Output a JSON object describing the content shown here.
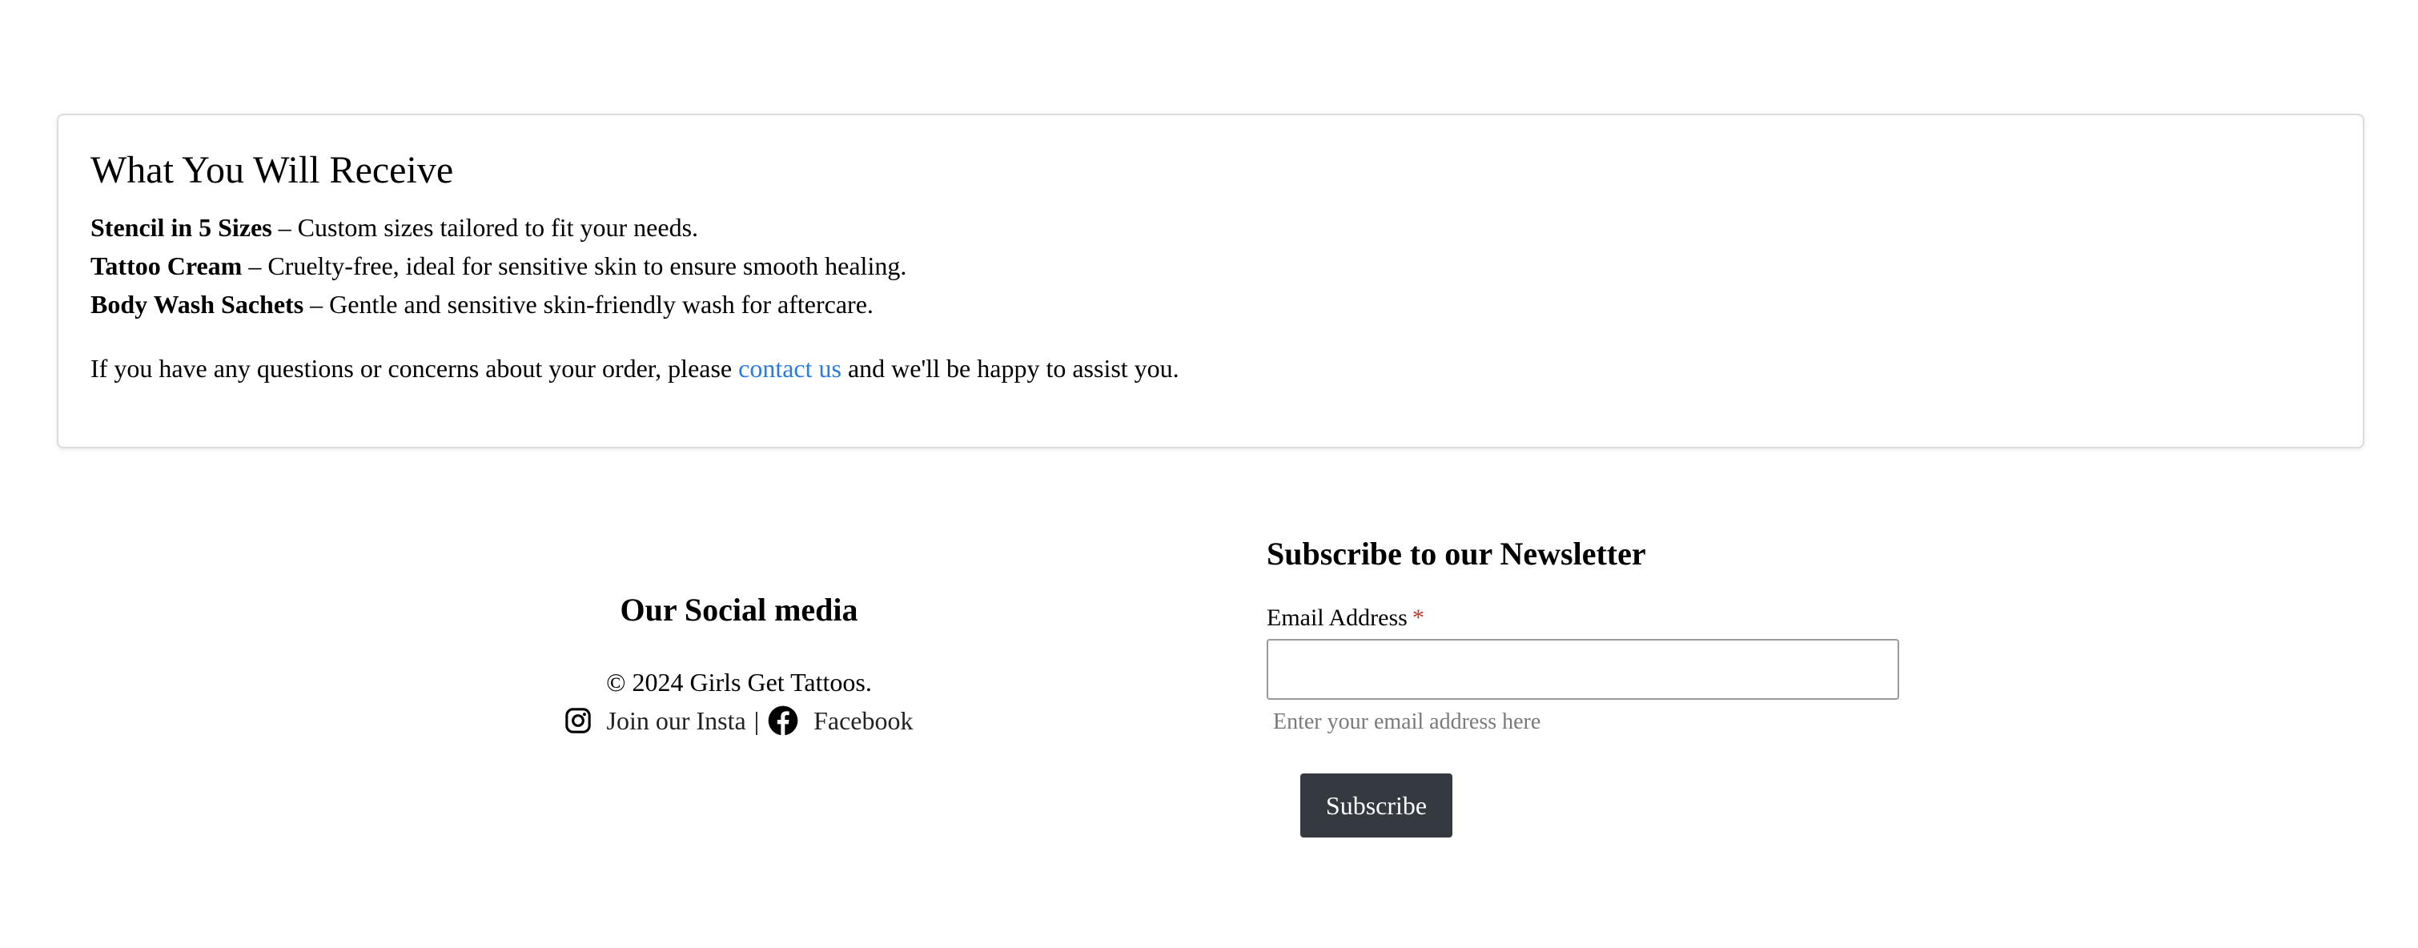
{
  "receive_card": {
    "title": "What You Will Receive",
    "items": [
      {
        "name": "Stencil in 5 Sizes",
        "desc": " – Custom sizes tailored to fit your needs."
      },
      {
        "name": "Tattoo Cream",
        "desc": " – Cruelty-free, ideal for sensitive skin to ensure smooth healing."
      },
      {
        "name": "Body Wash Sachets",
        "desc": " – Gentle and sensitive skin-friendly wash for aftercare."
      }
    ],
    "note_before": "If you have any questions or concerns about your order, please ",
    "note_link": "contact us",
    "note_after": " and we'll be happy to assist you.",
    "link_color": "#2a7ae2"
  },
  "social": {
    "title": "Our Social media",
    "copyright": "© 2024 Girls Get Tattoos.",
    "instagram_label": "Join our Insta",
    "separator": "|",
    "facebook_label": "Facebook",
    "icons": [
      "instagram-icon",
      "facebook-icon"
    ]
  },
  "newsletter": {
    "title": "Subscribe to our Newsletter",
    "email_label": "Email Address",
    "required_mark": "*",
    "email_value": "",
    "help_text": "Enter your email address here",
    "button_label": "Subscribe",
    "button_color": "#343a40"
  }
}
